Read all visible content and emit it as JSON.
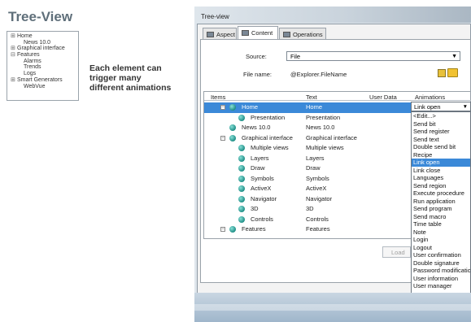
{
  "slide": {
    "title": "Tree-View",
    "caption_lines": [
      "Each element can",
      "trigger many",
      "different animations"
    ],
    "mini_tree": [
      {
        "toggle": "⊞",
        "label": "Home",
        "indent": 0
      },
      {
        "toggle": "",
        "label": "News 10.0",
        "indent": 1
      },
      {
        "toggle": "⊞",
        "label": "Graphical interface",
        "indent": 0
      },
      {
        "toggle": "⊟",
        "label": "Features",
        "indent": 0
      },
      {
        "toggle": "",
        "label": "Alarms",
        "indent": 1
      },
      {
        "toggle": "",
        "label": "Trends",
        "indent": 1
      },
      {
        "toggle": "",
        "label": "Logs",
        "indent": 1
      },
      {
        "toggle": "⊞",
        "label": "Smart Generators",
        "indent": 0
      },
      {
        "toggle": "",
        "label": "WebVue",
        "indent": 1
      }
    ]
  },
  "window": {
    "title": "Tree-view",
    "tabs": [
      {
        "label": "Aspect",
        "active": false
      },
      {
        "label": "Content",
        "active": true
      },
      {
        "label": "Operations",
        "active": false
      }
    ],
    "source_label": "Source:",
    "source_value": "File",
    "filename_label": "File name:",
    "filename_value": "@Explorer.FileName",
    "columns": [
      "Items",
      "Text",
      "User Data",
      "Animations"
    ],
    "rows": [
      {
        "toggle": "−",
        "item": "Home",
        "text": "Home",
        "selected": true,
        "level": 0
      },
      {
        "toggle": "",
        "item": "Presentation",
        "text": "Presentation",
        "selected": false,
        "level": 1
      },
      {
        "toggle": "",
        "item": "News 10.0",
        "text": "News 10.0",
        "selected": false,
        "level": 0
      },
      {
        "toggle": "−",
        "item": "Graphical interface",
        "text": "Graphical interface",
        "selected": false,
        "level": 0
      },
      {
        "toggle": "",
        "item": "Multiple views",
        "text": "Multiple views",
        "selected": false,
        "level": 1
      },
      {
        "toggle": "",
        "item": "Layers",
        "text": "Layers",
        "selected": false,
        "level": 1
      },
      {
        "toggle": "",
        "item": "Draw",
        "text": "Draw",
        "selected": false,
        "level": 1
      },
      {
        "toggle": "",
        "item": "Symbols",
        "text": "Symbols",
        "selected": false,
        "level": 1
      },
      {
        "toggle": "",
        "item": "ActiveX",
        "text": "ActiveX",
        "selected": false,
        "level": 1
      },
      {
        "toggle": "",
        "item": "Navigator",
        "text": "Navigator",
        "selected": false,
        "level": 1
      },
      {
        "toggle": "",
        "item": "3D",
        "text": "3D",
        "selected": false,
        "level": 1
      },
      {
        "toggle": "",
        "item": "Controls",
        "text": "Controls",
        "selected": false,
        "level": 1
      },
      {
        "toggle": "−",
        "item": "Features",
        "text": "Features",
        "selected": false,
        "level": 0
      }
    ],
    "animation_selected": "Link open",
    "animation_options": [
      "<Edit...>",
      "Send bit",
      "Send register",
      "Send text",
      "Double send bit",
      "Recipe",
      "Link open",
      "Link close",
      "Languages",
      "Send region",
      "Execute procedure",
      "Run application",
      "Send program",
      "Send macro",
      "Time table",
      "Note",
      "Login",
      "Logout",
      "User confirmation",
      "Double signature",
      "Password modification",
      "User information",
      "User manager"
    ],
    "highlighted_option": "Link open",
    "load_button": "Load"
  }
}
